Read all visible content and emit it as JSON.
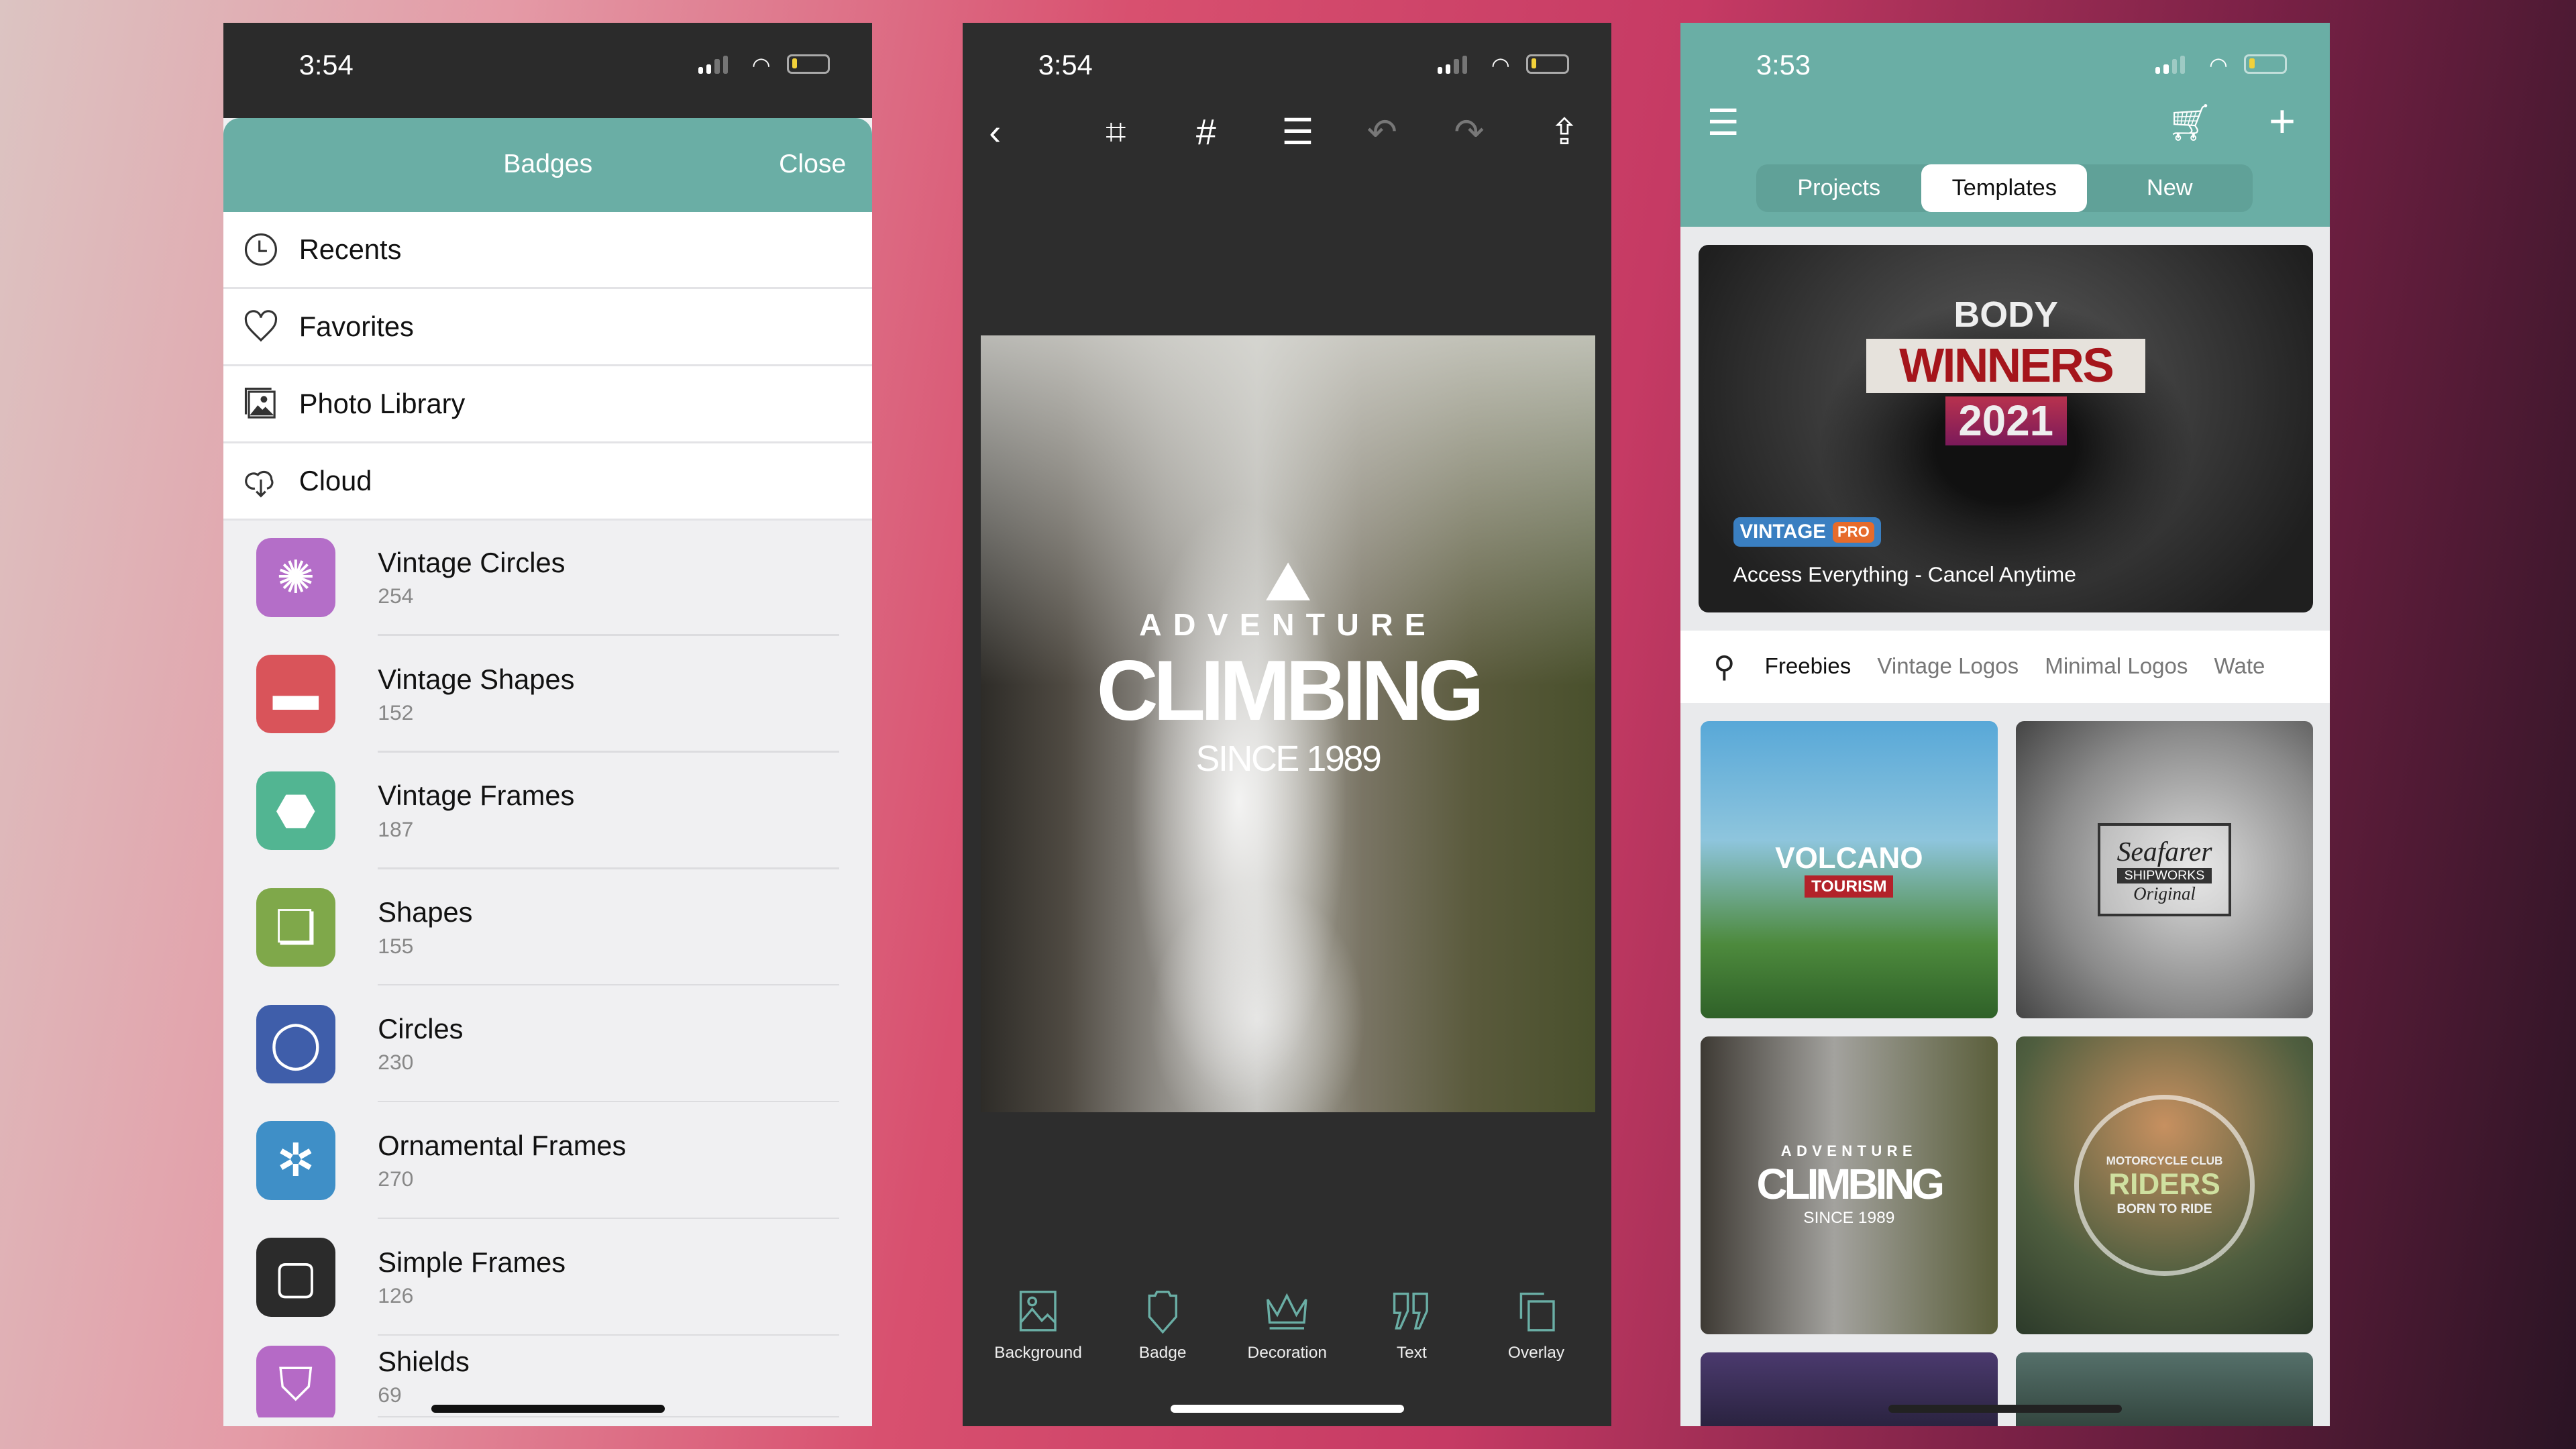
{
  "colors": {
    "teal": "#6aaea5",
    "dark": "#2d2d2d",
    "accent_pro": "#e66b2b",
    "vintage_blue": "#3a7fc1"
  },
  "left": {
    "status": {
      "time": "3:54"
    },
    "header": {
      "title": "Badges",
      "close": "Close"
    },
    "sources": [
      {
        "label": "Recents",
        "icon": "clock-icon"
      },
      {
        "label": "Favorites",
        "icon": "heart-icon"
      },
      {
        "label": "Photo Library",
        "icon": "photo-library-icon"
      },
      {
        "label": "Cloud",
        "icon": "cloud-download-icon"
      }
    ],
    "categories": [
      {
        "name": "Vintage Circles",
        "count": "254",
        "color": "#b46ec8"
      },
      {
        "name": "Vintage Shapes",
        "count": "152",
        "color": "#d9545a"
      },
      {
        "name": "Vintage Frames",
        "count": "187",
        "color": "#52b592"
      },
      {
        "name": "Shapes",
        "count": "155",
        "color": "#7fa84a"
      },
      {
        "name": "Circles",
        "count": "230",
        "color": "#3f5eaa"
      },
      {
        "name": "Ornamental Frames",
        "count": "270",
        "color": "#3f8fc7"
      },
      {
        "name": "Simple Frames",
        "count": "126",
        "color": "#2b2b2b"
      },
      {
        "name": "Shields",
        "count": "69",
        "color": "#b56ac6"
      }
    ]
  },
  "middle": {
    "status": {
      "time": "3:54"
    },
    "toolbar": [
      "back-icon",
      "crop-icon",
      "grid-icon",
      "layers-icon",
      "undo-icon",
      "redo-icon",
      "share-icon"
    ],
    "design": {
      "line1": "ADVENTURE",
      "line2": "CLIMBING",
      "line3": "SINCE 1989"
    },
    "tools": [
      {
        "label": "Background",
        "icon": "background-icon"
      },
      {
        "label": "Badge",
        "icon": "badge-icon"
      },
      {
        "label": "Decoration",
        "icon": "crown-icon"
      },
      {
        "label": "Text",
        "icon": "quote-icon"
      },
      {
        "label": "Overlay",
        "icon": "overlay-icon"
      }
    ]
  },
  "right": {
    "status": {
      "time": "3:53"
    },
    "tabs": [
      "Projects",
      "Templates",
      "New"
    ],
    "active_tab": "Templates",
    "banner": {
      "badge_top": "BODY",
      "badge_mid": "WINNERS",
      "badge_year": "2021",
      "brand": "VINTAGE",
      "pro": "PRO",
      "tagline": "Access Everything - Cancel Anytime"
    },
    "filters": [
      "Freebies",
      "Vintage Logos",
      "Minimal Logos",
      "Wate"
    ],
    "templates": [
      {
        "l1": "VOLCANO",
        "l2": "TOURISM"
      },
      {
        "l1": "Seafarer",
        "l2": "SHIPWORKS",
        "l3": "Original"
      },
      {
        "l1": "ADVENTURE",
        "l2": "CLIMBING",
        "l3": "SINCE 1989"
      },
      {
        "l1": "MOTORCYCLE CLUB",
        "l2": "RIDERS",
        "l3": "BORN TO RIDE"
      }
    ]
  }
}
